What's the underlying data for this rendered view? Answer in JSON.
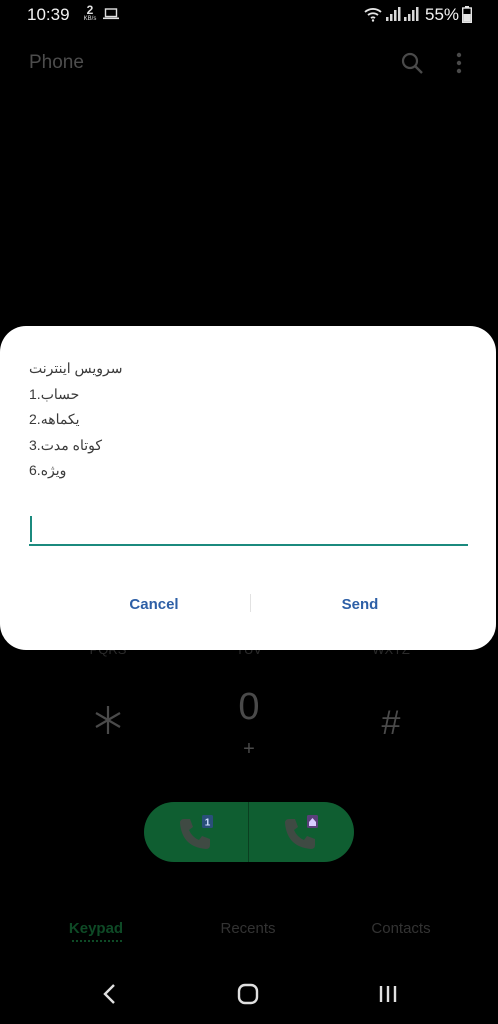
{
  "status_bar": {
    "time": "10:39",
    "net_speed_value": "2",
    "net_speed_unit": "KB/s",
    "battery_percent": "55%"
  },
  "app_bar": {
    "title": "Phone",
    "icons": [
      "search-icon",
      "more-vert-icon"
    ]
  },
  "dialog": {
    "lines": [
      "سرویس اینترنت",
      "1.حساب",
      "2.یکماهه",
      "3.کوتاه مدت",
      "6.ویژه"
    ],
    "input_value": "",
    "cancel_label": "Cancel",
    "send_label": "Send",
    "accent_color": "#1b8a7e",
    "button_color": "#2d5fa6"
  },
  "keypad": {
    "letters": [
      "PQRS",
      "TUV",
      "WXYZ"
    ],
    "star": "*",
    "zero": "0",
    "zero_sub": "+",
    "hash": "#",
    "call_sim1_badge": "1",
    "call_sim2_icon": "home-icon",
    "call_color": "#0f5e31"
  },
  "tabs": {
    "keypad": "Keypad",
    "recents": "Recents",
    "contacts": "Contacts"
  },
  "nav": {
    "icons": [
      "back-icon",
      "home-icon",
      "recent-apps-icon"
    ]
  }
}
